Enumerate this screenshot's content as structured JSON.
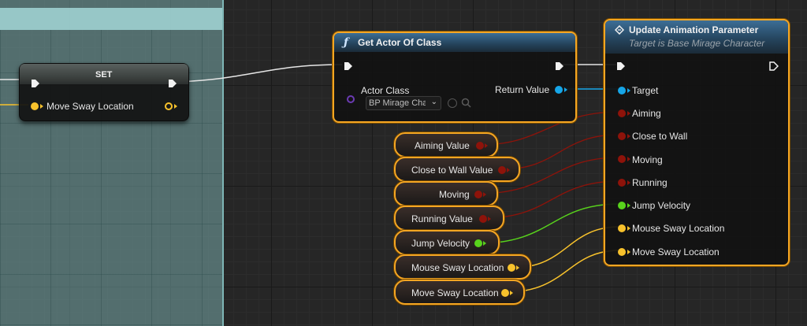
{
  "colors": {
    "exec": "#f2f2f2",
    "object": "#16a6e8",
    "bool": "#c0140a",
    "vector": "#f8c22c",
    "float": "#58d31c",
    "class": "#6b3bb3",
    "selection": "#f5a623"
  },
  "set_node": {
    "title": "SET",
    "pin_label": "Move Sway Location"
  },
  "get_actor_node": {
    "icon": "function-f-icon",
    "title": "Get Actor Of Class",
    "input_label": "Actor Class",
    "output_label": "Return Value",
    "class_value": "BP Mirage Char",
    "dropdown_arrow": "⌄"
  },
  "update_node": {
    "icon": "diamond-message-icon",
    "title": "Update Animation Parameter",
    "subtitle": "Target is Base Mirage Character",
    "pins": [
      "Target",
      "Aiming",
      "Close to Wall",
      "Moving",
      "Running",
      "Jump Velocity",
      "Mouse Sway Location",
      "Move Sway Location"
    ]
  },
  "variables": [
    "Aiming Value",
    "Close to Wall Value",
    "Moving",
    "Running Value",
    "Jump Velocity",
    "Mouse Sway Location",
    "Move Sway Location"
  ]
}
